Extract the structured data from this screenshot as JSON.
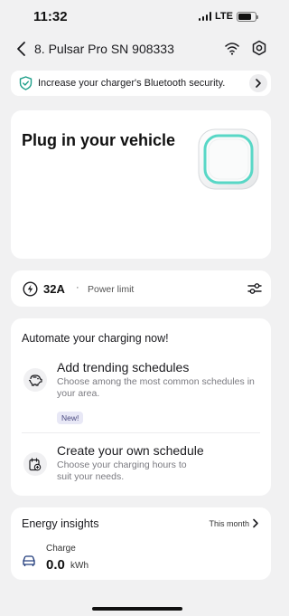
{
  "status_bar": {
    "time": "11:32",
    "network": "LTE",
    "icons": [
      "signal-icon",
      "battery-icon"
    ]
  },
  "nav": {
    "title": "8. Pulsar Pro SN 908333",
    "icons": [
      "back-icon",
      "wifi-icon",
      "gear-icon"
    ]
  },
  "banner": {
    "text": "Increase your charger's Bluetooth security.",
    "icons": [
      "shield-check-icon",
      "chevron-right-icon"
    ],
    "accent": "#1f9f8a"
  },
  "plugin_card": {
    "title": "Plug in your vehicle",
    "charger_ring_color": "#58d7c6"
  },
  "power_card": {
    "value": "32A",
    "separator": "·",
    "label": "Power limit",
    "icons": [
      "bolt-icon",
      "sliders-icon"
    ]
  },
  "automate_card": {
    "title": "Automate your charging now!",
    "items": [
      {
        "title": "Add trending schedules",
        "description": "Choose among the most common schedules in your area.",
        "badge": "New!",
        "icon": "piggy-bank-icon"
      },
      {
        "title": "Create your own schedule",
        "description": "Choose your charging hours to suit your needs.",
        "icon": "calendar-add-icon"
      }
    ]
  },
  "energy_card": {
    "title": "Energy insights",
    "period": "This month",
    "charge_label": "Charge",
    "charge_value": "0.0",
    "charge_unit": "kWh",
    "icons": [
      "car-icon",
      "chevron-right-icon"
    ]
  }
}
